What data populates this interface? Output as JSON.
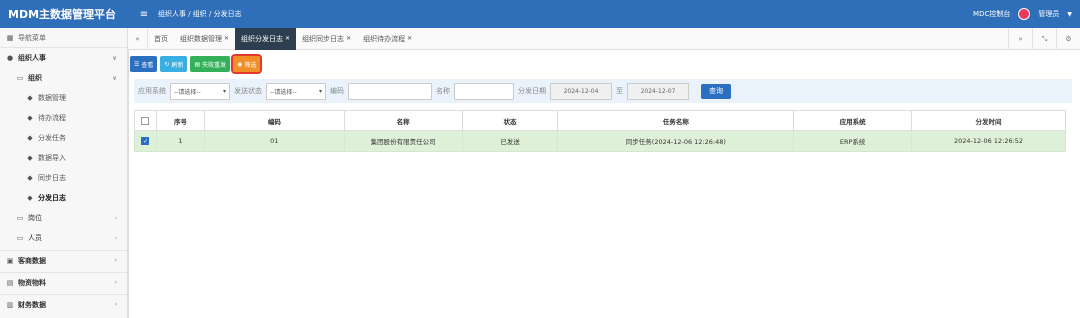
{
  "header": {
    "brand": "MDM主数据管理平台",
    "breadcrumb": "组织人事 / 组织 / 分发日志",
    "console_label": "MDC控制台",
    "user_label": "管理员"
  },
  "sidebar": {
    "title": "导航菜单",
    "items": [
      {
        "label": "组织人事"
      },
      {
        "label": "组织"
      },
      {
        "label": "数据管理"
      },
      {
        "label": "待办流程"
      },
      {
        "label": "分发任务"
      },
      {
        "label": "数据导入"
      },
      {
        "label": "同步日志"
      },
      {
        "label": "分发日志"
      },
      {
        "label": "岗位"
      },
      {
        "label": "人员"
      },
      {
        "label": "客商数据"
      },
      {
        "label": "物资物料"
      },
      {
        "label": "财务数据"
      }
    ]
  },
  "tabs": [
    {
      "label": "首页"
    },
    {
      "label": "组织数据管理"
    },
    {
      "label": "组织分发日志"
    },
    {
      "label": "组织同步日志"
    },
    {
      "label": "组织待办流程"
    }
  ],
  "toolbar": {
    "view": "查看",
    "refresh": "刷新",
    "resend": "失败重发",
    "filter": "筛选"
  },
  "search": {
    "app_label": "应用系统",
    "app_value": "--请选择--",
    "status_label": "发送状态",
    "status_value": "--请选择--",
    "code_label": "编码",
    "name_label": "名称",
    "date_label": "分发日期",
    "date_from": "2024-12-04",
    "to_label": "至",
    "date_to": "2024-12-07",
    "query_button": "查询"
  },
  "table": {
    "columns": [
      "序号",
      "编码",
      "名称",
      "状态",
      "任务名称",
      "应用系统",
      "分发时间"
    ],
    "rows": [
      [
        "1",
        "01",
        "集团股份有限责任公司",
        "已发送",
        "同步任务(2024-12-06 12:26:48)",
        "ERP系统",
        "2024-12-06 12:26:52"
      ]
    ]
  }
}
